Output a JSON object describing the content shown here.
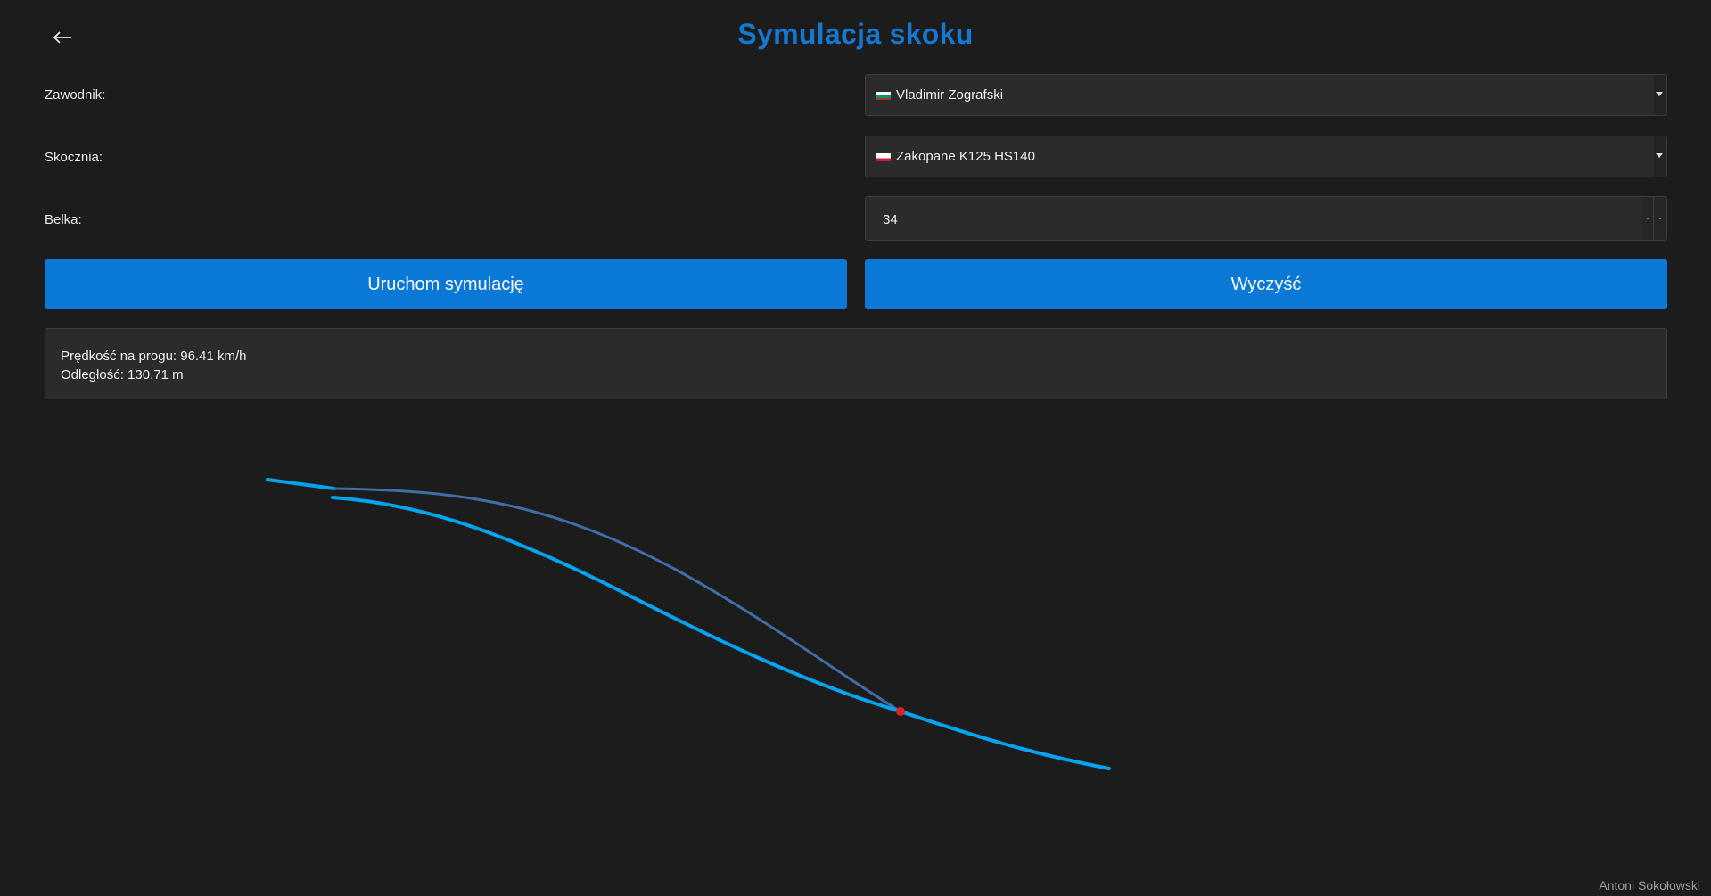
{
  "header": {
    "back_icon": "arrow-left-icon",
    "title": "Symulacja skoku"
  },
  "form": {
    "jumper_label": "Zawodnik:",
    "jumper_value": "Vladimir Zografski",
    "jumper_flag_colors": [
      "#ffffff",
      "#00966e",
      "#d62612"
    ],
    "hill_label": "Skocznia:",
    "hill_value": "Zakopane K125 HS140",
    "hill_flag_colors": [
      "#ffffff",
      "#dc143c"
    ],
    "gate_label": "Belka:",
    "gate_value": "34"
  },
  "buttons": {
    "run_label": "Uruchom symulację",
    "clear_label": "Wyczyść"
  },
  "results": {
    "speed_line": "Prędkość na progu: 96.41 km/h",
    "distance_line": "Odległość: 130.71 m"
  },
  "colors": {
    "accent": "#0a78d6",
    "hill_profile": "#00a3f0",
    "flight_path": "#3e6da8",
    "landing_point": "#e0202a"
  },
  "footer": {
    "author": "Antoni Sokołowski"
  }
}
